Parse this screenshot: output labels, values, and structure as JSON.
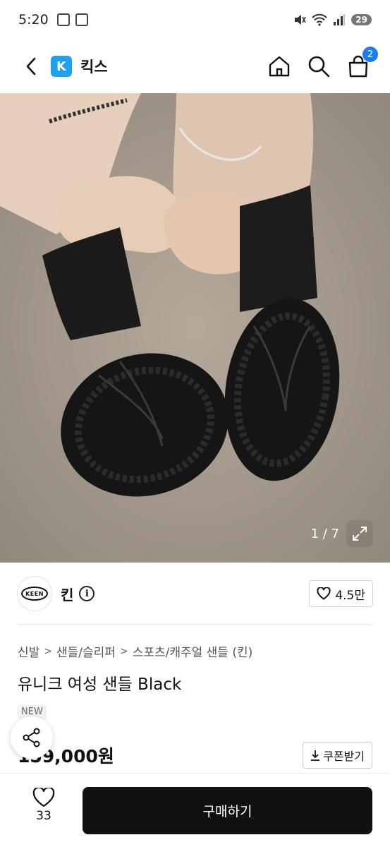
{
  "status_bar": {
    "time": "5:20",
    "battery": "29"
  },
  "header": {
    "store_logo_letter": "K",
    "store_name": "킥스",
    "cart_count": "2"
  },
  "hero": {
    "counter": "1 / 7"
  },
  "brand": {
    "logo_text": "KEEN",
    "name": "킨",
    "likes": "4.5만"
  },
  "breadcrumb": [
    "신발",
    "샌들/슬리퍼",
    "스포츠/캐주얼 샌들 (킨)"
  ],
  "product": {
    "title": "유니크 여성 샌들 Black",
    "badge": "NEW",
    "price": "159,000원"
  },
  "actions": {
    "coupon_label": "쿠폰받기",
    "wish_count": "33",
    "buy_label": "구매하기"
  },
  "colors": {
    "buy_button": "#111111",
    "brand_blue": "#1da1f2",
    "badge_blue": "#1b7cf2"
  },
  "icons": [
    "back-icon",
    "home-icon",
    "search-icon",
    "cart-icon",
    "expand-icon",
    "info-icon",
    "heart-icon",
    "share-icon",
    "download-icon"
  ]
}
